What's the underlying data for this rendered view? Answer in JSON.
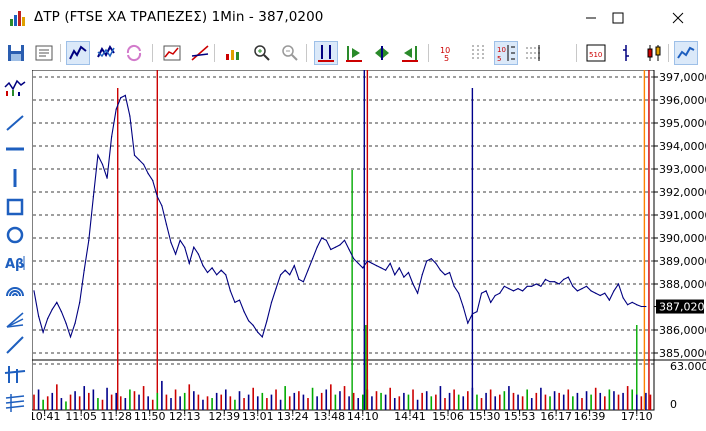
{
  "window": {
    "title": "ΔΤΡ (FTSE XA ΤΡΑΠΕΖΕΣ) 1Min - 387,0200",
    "app_icon": "chart-app-icon",
    "controls": [
      "minimize-icon",
      "maximize-icon",
      "close-icon"
    ]
  },
  "toolbar": {
    "buttons": [
      {
        "name": "save-icon",
        "active": false
      },
      {
        "name": "properties-icon",
        "active": false
      },
      {
        "name": "line-chart-mode-icon",
        "active": true
      },
      {
        "name": "compare-chart-icon",
        "active": false
      },
      {
        "name": "refresh-icon",
        "active": false
      },
      {
        "name": "indicator-chart-icon",
        "active": false
      },
      {
        "name": "trendline-chart-icon",
        "active": false
      },
      {
        "name": "add-indicator-icon",
        "active": false
      },
      {
        "name": "zoom-in-icon",
        "active": false
      },
      {
        "name": "zoom-out-icon",
        "active": false
      },
      {
        "name": "fit-height-icon",
        "active": true
      },
      {
        "name": "scroll-start-icon",
        "active": false
      },
      {
        "name": "center-icon",
        "active": false
      },
      {
        "name": "scroll-end-icon",
        "active": false
      },
      {
        "name": "decimal-icon",
        "active": false
      },
      {
        "name": "grid-vertical-icon",
        "active": false
      },
      {
        "name": "grid-horizontal-icon",
        "active": true
      },
      {
        "name": "grid-both-icon",
        "active": false
      },
      {
        "name": "grid-values-icon",
        "active": false
      },
      {
        "name": "bar-chart-type-icon",
        "active": false
      },
      {
        "name": "candlestick-chart-type-icon",
        "active": false
      },
      {
        "name": "line-chart-type-icon",
        "active": true
      },
      {
        "name": "point-figure-icon",
        "active": false
      }
    ]
  },
  "drawing_tools": [
    "price-volume-icon",
    "trend-line-icon",
    "horizontal-line-icon",
    "vertical-line-icon",
    "rectangle-icon",
    "ellipse-icon",
    "text-tool-icon",
    "arc-tool-icon",
    "fan-tool-icon",
    "ray-tool-icon",
    "cross-hair-tool-icon",
    "fibonacci-tool-icon"
  ],
  "colors": {
    "price_line": "#000080",
    "volume_red": "#cc0000",
    "volume_blue": "#00008b",
    "volume_green": "#00aa00",
    "grid": "#000000",
    "marker_red": "#cc0000",
    "marker_orange": "#ff8000",
    "marker_blue": "#00008b",
    "marker_green": "#00aa00"
  },
  "chart_data": {
    "type": "line",
    "title": "ΔΤΡ (FTSE XA ΤΡΑΠΕΖΕΣ) 1Min",
    "last_value": "387,0200",
    "price_axis_labels": [
      "397,0000",
      "396,0000",
      "395,0000",
      "394,0000",
      "393,0000",
      "392,0000",
      "391,0000",
      "390,0000",
      "389,0000",
      "388,0000",
      "387,0200",
      "386,0000",
      "385,0000"
    ],
    "price_ylim": [
      385.0,
      397.0
    ],
    "volume_axis_labels": [
      "63.000",
      "0"
    ],
    "volume_ylim": [
      0,
      63000
    ],
    "time_labels": [
      "10:41",
      "11:05",
      "11:28",
      "11:50",
      "12:13",
      "12:39",
      "13:01",
      "13:24",
      "13:48",
      "14:10",
      "14:41",
      "15:06",
      "15:30",
      "15:53",
      "16:17",
      "16:39",
      "17:10"
    ],
    "time_ticks_minutes": [
      641,
      665,
      688,
      710,
      733,
      759,
      781,
      804,
      828,
      850,
      881,
      906,
      930,
      953,
      977,
      999,
      1030
    ],
    "grid": "horizontal",
    "series": [
      {
        "name": "price",
        "x_minutes": [
          634,
          637,
          640,
          643,
          646,
          649,
          652,
          655,
          658,
          661,
          664,
          667,
          670,
          673,
          676,
          679,
          682,
          685,
          688,
          691,
          694,
          697,
          700,
          703,
          706,
          709,
          712,
          715,
          718,
          721,
          724,
          727,
          730,
          733,
          736,
          739,
          742,
          745,
          748,
          751,
          754,
          757,
          760,
          763,
          766,
          769,
          772,
          775,
          778,
          781,
          784,
          787,
          790,
          793,
          796,
          799,
          802,
          805,
          808,
          811,
          814,
          817,
          820,
          823,
          826,
          829,
          832,
          835,
          838,
          841,
          844,
          847,
          850,
          853,
          856,
          859,
          862,
          865,
          868,
          871,
          874,
          877,
          880,
          883,
          886,
          889,
          892,
          895,
          898,
          901,
          904,
          907,
          910,
          913,
          916,
          919,
          922,
          925,
          928,
          931,
          934,
          937,
          940,
          943,
          946,
          949,
          952,
          955,
          958,
          961,
          964,
          967,
          970,
          973,
          976,
          979,
          982,
          985,
          988,
          991,
          994,
          997,
          1000,
          1003,
          1006,
          1009,
          1012,
          1015,
          1018,
          1021,
          1024,
          1027,
          1030,
          1033,
          1036
        ],
        "y": [
          387.7,
          386.6,
          385.9,
          386.5,
          386.9,
          387.2,
          386.8,
          386.3,
          385.7,
          386.3,
          387.2,
          388.6,
          389.9,
          391.8,
          393.6,
          393.2,
          392.6,
          394.4,
          395.6,
          396.1,
          396.2,
          395.3,
          393.6,
          393.4,
          393.2,
          392.8,
          392.5,
          391.8,
          391.4,
          390.6,
          389.8,
          389.3,
          389.9,
          389.6,
          388.9,
          389.6,
          389.3,
          388.8,
          388.5,
          388.7,
          388.4,
          388.6,
          388.4,
          387.7,
          387.2,
          387.3,
          386.8,
          386.4,
          386.2,
          385.9,
          385.7,
          386.4,
          387.2,
          387.8,
          388.4,
          388.6,
          388.4,
          388.8,
          388.2,
          388.1,
          388.6,
          389.1,
          389.6,
          390.0,
          389.9,
          389.5,
          389.6,
          389.7,
          389.9,
          389.5,
          389.1,
          388.9,
          388.7,
          389.0,
          388.9,
          388.8,
          388.7,
          388.6,
          388.9,
          388.4,
          388.7,
          388.3,
          388.5,
          388.0,
          387.6,
          388.4,
          389.0,
          389.1,
          388.9,
          388.6,
          388.4,
          388.5,
          387.9,
          387.6,
          387.0,
          386.3,
          386.7,
          386.8,
          387.6,
          387.7,
          387.2,
          387.5,
          387.6,
          387.9,
          387.8,
          387.7,
          387.8,
          387.7,
          387.9,
          387.9,
          388.0,
          387.9,
          388.2,
          388.1,
          388.1,
          388.0,
          388.2,
          388.3,
          387.9,
          387.7,
          387.8,
          387.9,
          387.7,
          387.6,
          387.5,
          387.6,
          387.3,
          387.7,
          388.0,
          387.4,
          387.1,
          387.2,
          387.1,
          387.02,
          387.02
        ]
      },
      {
        "name": "volume",
        "values": [
          9,
          12,
          6,
          8,
          10,
          15,
          7,
          5,
          9,
          11,
          8,
          14,
          10,
          12,
          7,
          6,
          13,
          9,
          10,
          8,
          7,
          12,
          11,
          9,
          14,
          8,
          6,
          10,
          17,
          9,
          7,
          12,
          8,
          10,
          15,
          11,
          9,
          6,
          8,
          7,
          10,
          9,
          12,
          8,
          6,
          11,
          7,
          9,
          13,
          8,
          10,
          7,
          9,
          12,
          6,
          14,
          8,
          10,
          11,
          9,
          7,
          13,
          8,
          10,
          12,
          15,
          9,
          11,
          14,
          8,
          10,
          7,
          9,
          12,
          8,
          11,
          10,
          9,
          13,
          7,
          8,
          10,
          9,
          12,
          6,
          10,
          11,
          8,
          9,
          14,
          7,
          10,
          12,
          9,
          8,
          11,
          13,
          9,
          7,
          10,
          12,
          8,
          9,
          11,
          14,
          10,
          9,
          8,
          12,
          7,
          10,
          13,
          9,
          8,
          11,
          10,
          9,
          12,
          8,
          10,
          7,
          11,
          9,
          13,
          10,
          8,
          12,
          11,
          9,
          10,
          14,
          12,
          9,
          8,
          10,
          9
        ],
        "colors": [
          "r",
          "b",
          "g",
          "r",
          "b",
          "r",
          "b",
          "g",
          "r",
          "b",
          "r",
          "b",
          "r",
          "b",
          "g",
          "r",
          "b",
          "r",
          "b",
          "r",
          "b",
          "g",
          "r",
          "b",
          "r",
          "b",
          "r",
          "g",
          "b",
          "r",
          "b",
          "r",
          "b",
          "g",
          "r",
          "b",
          "r",
          "b",
          "r",
          "g",
          "b",
          "r",
          "b",
          "r",
          "g",
          "b",
          "r",
          "b",
          "r",
          "b",
          "g",
          "r",
          "b",
          "r",
          "b",
          "g",
          "r",
          "b",
          "r",
          "b",
          "r",
          "g",
          "b",
          "r",
          "b",
          "r",
          "g",
          "b",
          "r",
          "b",
          "r",
          "b",
          "g",
          "r",
          "b",
          "r",
          "g",
          "b",
          "r",
          "b",
          "r",
          "b",
          "g",
          "r",
          "b",
          "r",
          "b",
          "g",
          "r",
          "b",
          "r",
          "b",
          "r",
          "g",
          "b",
          "r",
          "b",
          "g",
          "r",
          "b",
          "r",
          "b",
          "r",
          "g",
          "b",
          "r",
          "b",
          "r",
          "g",
          "b",
          "r",
          "b",
          "r",
          "g",
          "b",
          "r",
          "b",
          "r",
          "g",
          "b",
          "r",
          "b",
          "g",
          "r",
          "b",
          "r",
          "g",
          "b",
          "r",
          "b",
          "r",
          "g",
          "b",
          "r",
          "b",
          "r"
        ]
      }
    ],
    "markers": [
      {
        "time_minutes": 689,
        "color": "red",
        "height": "tall"
      },
      {
        "time_minutes": 715,
        "color": "red",
        "height": "full"
      },
      {
        "time_minutes": 843,
        "color": "green",
        "height": "medium"
      },
      {
        "time_minutes": 851,
        "color": "blue",
        "height": "full"
      },
      {
        "time_minutes": 853,
        "color": "red",
        "height": "full"
      },
      {
        "time_minutes": 852,
        "color": "green",
        "height": "short"
      },
      {
        "time_minutes": 922,
        "color": "blue",
        "height": "tall"
      },
      {
        "time_minutes": 1035,
        "color": "orange",
        "height": "full"
      },
      {
        "time_minutes": 1038,
        "color": "red",
        "height": "full"
      },
      {
        "time_minutes": 1030,
        "color": "green",
        "height": "short"
      }
    ]
  }
}
